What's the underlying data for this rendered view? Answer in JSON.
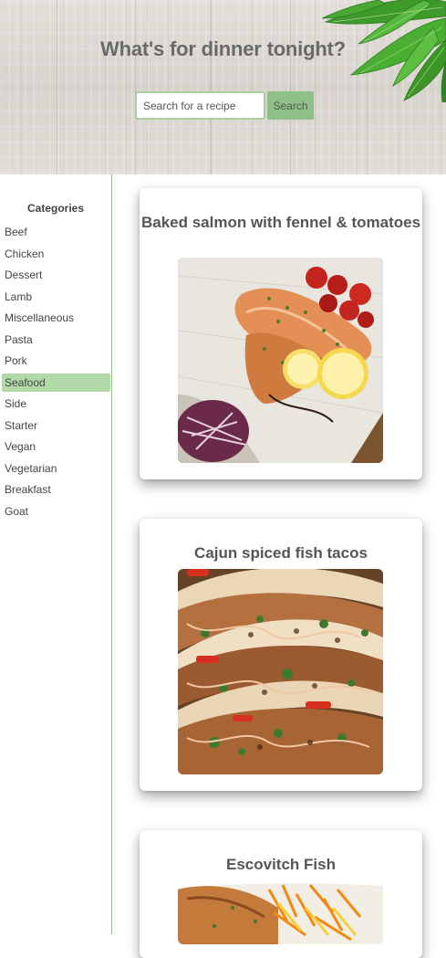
{
  "header": {
    "title": "What's for dinner tonight?",
    "search_placeholder": "Search for a recipe",
    "search_button": "Search"
  },
  "sidebar": {
    "heading": "Categories",
    "items": [
      "Beef",
      "Chicken",
      "Dessert",
      "Lamb",
      "Miscellaneous",
      "Pasta",
      "Pork",
      "Seafood",
      "Side",
      "Starter",
      "Vegan",
      "Vegetarian",
      "Breakfast",
      "Goat"
    ],
    "active": "Seafood"
  },
  "recipes": [
    {
      "title": "Baked salmon with fennel & tomatoes",
      "image": "baked-salmon-photo"
    },
    {
      "title": "Cajun spiced fish tacos",
      "image": "fish-tacos-photo"
    },
    {
      "title": "Escovitch Fish",
      "image": "escovitch-fish-photo"
    }
  ],
  "colors": {
    "accent": "#8fc08a",
    "active_category": "#b2d9a8",
    "title_text": "#6a6a64"
  }
}
